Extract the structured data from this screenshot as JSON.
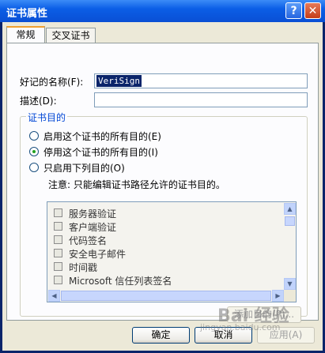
{
  "window": {
    "title": "证书属性",
    "help_glyph": "?",
    "close_glyph": "✕"
  },
  "tabs": [
    {
      "label": "常规"
    },
    {
      "label": "交叉证书"
    }
  ],
  "fields": {
    "friendly_name_label": "好记的名称(F):",
    "friendly_name_value": "VeriSign",
    "description_label": "描述(D):",
    "description_value": ""
  },
  "purposes": {
    "group_title": "证书目的",
    "options": [
      {
        "label": "启用这个证书的所有目的(E)",
        "selected": false
      },
      {
        "label": "停用这个证书的所有目的(I)",
        "selected": true
      },
      {
        "label": "只启用下列目的(O)",
        "selected": false
      }
    ],
    "note": "注意: 只能编辑证书路径允许的证书目的。",
    "items": [
      {
        "label": "服务器验证",
        "checked": false
      },
      {
        "label": "客户端验证",
        "checked": false
      },
      {
        "label": "代码签名",
        "checked": false
      },
      {
        "label": "安全电子邮件",
        "checked": false
      },
      {
        "label": "时间戳",
        "checked": false
      },
      {
        "label": "Microsoft 信任列表签名",
        "checked": false
      }
    ],
    "add_button": "添加目的(P)..."
  },
  "footer": {
    "ok": "确定",
    "cancel": "取消",
    "apply": "应用(A)"
  },
  "watermark": {
    "text": "Bai 经验",
    "url": "jingyan.baidu.com"
  }
}
